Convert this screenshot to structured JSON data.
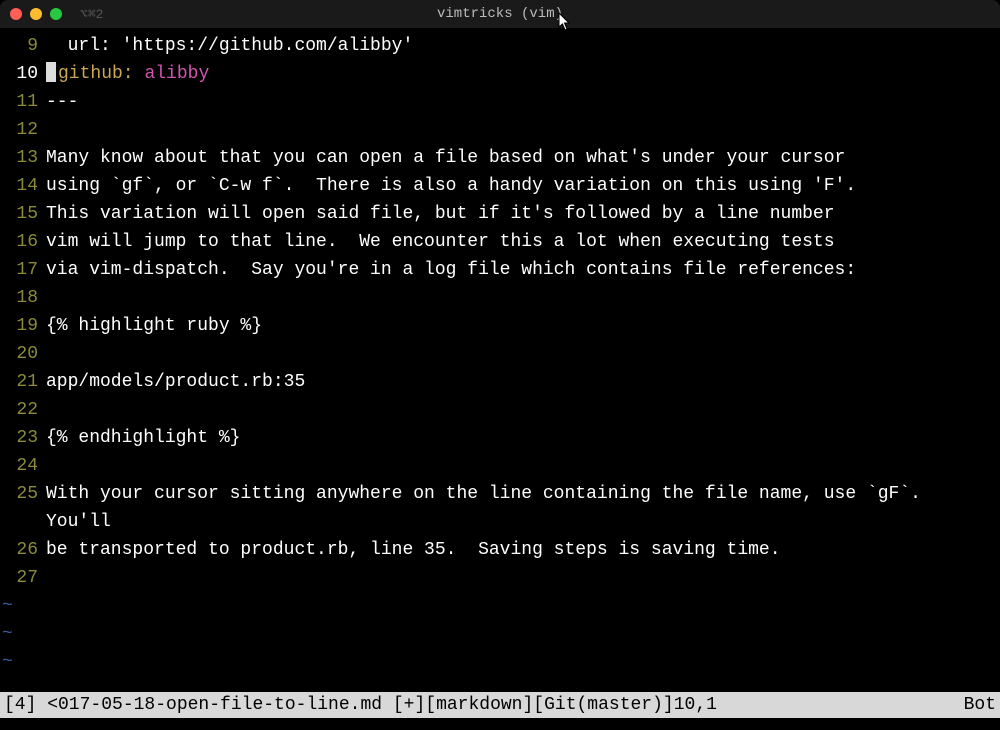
{
  "titlebar": {
    "hint": "⌥⌘2",
    "title": "vimtricks (vim)"
  },
  "lines": {
    "9": {
      "num": "9",
      "plain": "  url: 'https://github.com/alibby'"
    },
    "10": {
      "num": "10",
      "key": "github:",
      "val": "alibby"
    },
    "11": {
      "num": "11",
      "plain": "---"
    },
    "12": {
      "num": "12",
      "plain": ""
    },
    "13": {
      "num": "13",
      "plain": "Many know about that you can open a file based on what's under your cursor"
    },
    "14": {
      "num": "14",
      "plain": "using `gf`, or `C-w f`.  There is also a handy variation on this using 'F'."
    },
    "15": {
      "num": "15",
      "plain": "This variation will open said file, but if it's followed by a line number"
    },
    "16": {
      "num": "16",
      "plain": "vim will jump to that line.  We encounter this a lot when executing tests"
    },
    "17": {
      "num": "17",
      "plain": "via vim-dispatch.  Say you're in a log file which contains file references:"
    },
    "18": {
      "num": "18",
      "plain": ""
    },
    "19": {
      "num": "19",
      "plain": "{% highlight ruby %}"
    },
    "20": {
      "num": "20",
      "plain": ""
    },
    "21": {
      "num": "21",
      "plain": "app/models/product.rb:35"
    },
    "22": {
      "num": "22",
      "plain": ""
    },
    "23": {
      "num": "23",
      "plain": "{% endhighlight %}"
    },
    "24": {
      "num": "24",
      "plain": ""
    },
    "25": {
      "num": "25",
      "plain": "With your cursor sitting anywhere on the line containing the file name, use `gF`.  You'll"
    },
    "26": {
      "num": "26",
      "plain": "be transported to product.rb, line 35.  Saving steps is saving time."
    },
    "27": {
      "num": "27",
      "plain": ""
    }
  },
  "tilde": "~",
  "statusbar": {
    "left": "[4] <017-05-18-open-file-to-line.md [+][markdown][Git(master)]10,1",
    "right": "Bot"
  }
}
